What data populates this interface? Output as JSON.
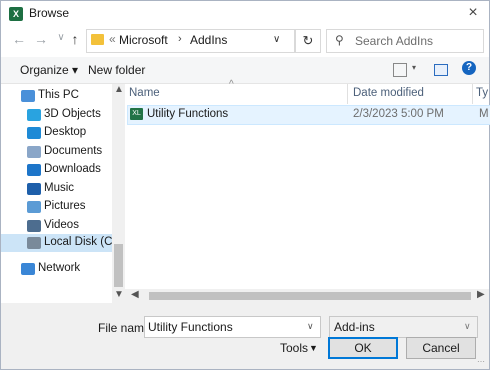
{
  "window": {
    "title": "Browse",
    "app_icon_letter": "X",
    "close_glyph": "×"
  },
  "nav_buttons": {
    "back": "←",
    "forward": "→",
    "recent": "∨",
    "up": "↑"
  },
  "address": {
    "overflow": "«",
    "crumbs": [
      "Microsoft",
      "AddIns"
    ],
    "separator": "›"
  },
  "search": {
    "placeholder": "Search AddIns"
  },
  "toolbar": {
    "organize_label": "Organize ▾",
    "new_folder_label": "New folder",
    "help_glyph": "?"
  },
  "nav_pane": {
    "items": [
      {
        "label": "This PC",
        "icon": "pc-icon",
        "color": "#4a90d9"
      },
      {
        "label": "3D Objects",
        "icon": "cube-icon",
        "color": "#29a3e0"
      },
      {
        "label": "Desktop",
        "icon": "desktop-icon",
        "color": "#1e8ad6"
      },
      {
        "label": "Documents",
        "icon": "document-icon",
        "color": "#8aa6c8"
      },
      {
        "label": "Downloads",
        "icon": "download-icon",
        "color": "#1d75c9"
      },
      {
        "label": "Music",
        "icon": "music-icon",
        "color": "#1e5faa"
      },
      {
        "label": "Pictures",
        "icon": "picture-icon",
        "color": "#5b9bd5"
      },
      {
        "label": "Videos",
        "icon": "video-icon",
        "color": "#4d6d8f"
      },
      {
        "label": "Local Disk (C:)",
        "icon": "disk-icon",
        "color": "#7a8a9a"
      },
      {
        "label": "Network",
        "icon": "network-icon",
        "color": "#3a86d6"
      }
    ]
  },
  "file_list": {
    "columns": [
      "Name",
      "Date modified",
      "Ty"
    ],
    "sort_glyph": "^",
    "rows": [
      {
        "name": "Utility Functions",
        "date": "2/3/2023 5:00 PM",
        "type": "M"
      }
    ]
  },
  "footer": {
    "file_name_label": "File name:",
    "file_name_value": "Utility Functions",
    "filter_value": "Add-ins",
    "tools_label": "Tools",
    "ok_label": "OK",
    "cancel_label": "Cancel"
  }
}
